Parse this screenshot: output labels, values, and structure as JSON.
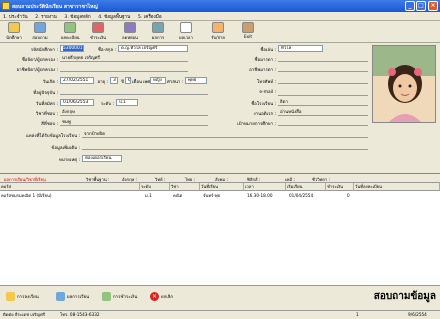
{
  "window": {
    "title": "สอบถามประวัตินักเรียน สาขาราชาไหญ่"
  },
  "menu": [
    "1. ประจำวัน",
    "2. รายงาน",
    "3. ข้อมูลหลัก",
    "4. ข้อมูลพื้นฐาน",
    "5. เครื่องมือ"
  ],
  "toolbar": [
    "นักศึกษา",
    "สอบถาม",
    "ลงทะเบียน",
    "ชำระเงิน",
    "ลดหย่อน",
    "ผลการ",
    "ผลเวลา",
    "รับ/จ่าย",
    "Exit"
  ],
  "form": {
    "student_id_label": "รหัสนักศึกษา :",
    "student_id": "5300001",
    "name_label": "ชื่อ-สกุล :",
    "name": "ด.ญ.ทิวไล เจริญศรี",
    "nickname_label": "ชื่อเล่น :",
    "nickname": "ทิวไล",
    "father_label": "ชื่อบิดา/ผู้ปกครอง :",
    "father": "นายธีรยุทธ เจริญศรี",
    "father_job_label": "อาชีพบิดา/ผู้ปกครอง :",
    "father_job": "",
    "mother_label": "ชื่อมารดา :",
    "mother": "",
    "mother_job_label": "อาชีพมารดา :",
    "mother_job": "",
    "birth_label": "วันเกิด :",
    "birth": "27/02/2551",
    "age_label": "อายุ :",
    "age": "3",
    "age_unit": "ปี",
    "month_label": "เดือน",
    "month": "6",
    "sex_label": "เพศ",
    "sex": "หญิง",
    "religion_label": "ศาสนา :",
    "religion": "พุทธ",
    "phone_label": "โทรศัพท์ :",
    "phone": "",
    "address_label": "ที่อยู่ปัจจุบัน :",
    "address": "",
    "email_label": "e-mail :",
    "email": "",
    "enroll_label": "วันที่สมัคร :",
    "enroll": "01/06/2553",
    "level_label": "ระดับ :",
    "level": "ป.1",
    "parent_level_label": "ชื่อโรงเรียน :",
    "parent_level": "ธิดา",
    "subject_label": "วิชาที่ชอบ :",
    "subject": "อังกฤษ",
    "hobby_label": "งานอดิเรก :",
    "hobby": "อ่านหนังสือ",
    "color_label": "สีที่ชอบ :",
    "color": "ชมพู",
    "goal_label": "เป้าหมายการศึกษา :",
    "goal": "",
    "source_label": "แหล่งที่ได้รับข้อมูลโรงเรียน :",
    "source": "จากป้ายปิด",
    "note_label": "ข้อมูลเพิ่มเติม :",
    "note": "",
    "remark_label": "หมายเหตุ :",
    "remark": "ห้องเดอร์เรียน"
  },
  "filter": {
    "label": "ผลการเรียน/วิชาที่เรียน",
    "items": [
      "วิชาพื้นฐาน :",
      "อังกฤษ :",
      "วิทย์ :",
      "ไทย :",
      "สังคม :",
      "ฟิสิกส์ :",
      "เคมี :",
      "ชีววิทยา :"
    ]
  },
  "table": {
    "headers": [
      "คอร์ส",
      "ระดับ",
      "วิชา",
      "วันที่เรียน",
      "เวลา",
      "เริ่มเรียน",
      "ชำระเงิน",
      "วันที่ลงทะเบียน"
    ],
    "rows": [
      [
        "คอร์สชมรมคณิต 1 (มีเรียน)",
        "ม.1",
        "คณิต",
        "จันทร์-พุธ",
        "16.30-18.00",
        "01/04/2554",
        "0",
        ""
      ]
    ]
  },
  "bottom": {
    "buttons": [
      "การลงเรียน",
      "ผลการเรียน",
      "การชำระเงิน",
      "ยกเลิก"
    ],
    "big_title": "สอบถามข้อมูล"
  },
  "status": {
    "user": "ติดต่อ ธีระเดช เจริญศรี",
    "phone": "โทร. 08-1543-6332",
    "page": "1",
    "date": "9/6/2554"
  }
}
